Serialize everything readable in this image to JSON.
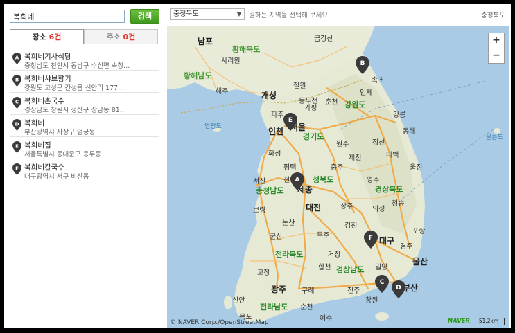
{
  "search": {
    "value": "복희네",
    "button": "검색"
  },
  "tabs": [
    {
      "label": "장소",
      "count": "6건"
    },
    {
      "label": "주소",
      "count": "0건"
    }
  ],
  "results": [
    {
      "marker": "A",
      "title": "복희네기사식당",
      "address": "충청남도 천안시 동남구 수신면 속창..."
    },
    {
      "marker": "B",
      "title": "복희네샤브향기",
      "address": "강원도 고성군 간성읍 신안리 177..."
    },
    {
      "marker": "C",
      "title": "복희네촌국수",
      "address": "경상남도 창원시 성산구 상남동 81..."
    },
    {
      "marker": "D",
      "title": "복희네",
      "address": "부산광역시 사상구 엄궁동"
    },
    {
      "marker": "E",
      "title": "복희네집",
      "address": "서울특별시 동대문구 용두동"
    },
    {
      "marker": "F",
      "title": "복희네칼국수",
      "address": "대구광역시 서구 비산동"
    }
  ],
  "mapbar": {
    "region": "충청북도",
    "hint": "원하는 지역을 선택해 보세요",
    "current": "충청북도"
  },
  "map": {
    "zoom_in": "+",
    "zoom_out": "−",
    "copyright": "© NAVER Corp./OpenStreetMap",
    "logo": "NAVER",
    "scale": "51.2km",
    "labels": {
      "nampo": "남포",
      "hwanghae_n": "황해북도",
      "sariwon": "사리원",
      "geumgang": "금강산",
      "hwanghae_s": "황해남도",
      "haeju": "해주",
      "gaeseong": "개성",
      "cheorwon": "철원",
      "inje": "인제",
      "sokcho": "속초",
      "chuncheon": "춘천",
      "gapyeong": "가평",
      "gangwon": "강원도",
      "paju": "파주",
      "dongducheon": "동두천",
      "yeonpyeong": "연평도",
      "incheon": "인천",
      "seoul": "서울",
      "gangneung": "강릉",
      "donghae": "동해",
      "gyeonggi": "경기도",
      "wonju": "원주",
      "ulleung": "울릉도",
      "jeongseon": "정선",
      "hwaseong": "화성",
      "jecheon": "제천",
      "taebaek": "태백",
      "pyeongtaek": "평택",
      "chungju": "충주",
      "uljin": "울진",
      "seosan": "서산",
      "cheonan": "천안",
      "chungbuk": "청북도",
      "sejong": "세종",
      "chungnam": "충청남도",
      "yeongju": "영주",
      "gyeongbuk": "경상북도",
      "boryeong": "보령",
      "daejeon": "대전",
      "sangju": "상주",
      "uiseong": "의성",
      "cheongsong": "청송",
      "nonsan": "논산",
      "gimcheon": "김천",
      "pohang": "포항",
      "gunsan": "군산",
      "muju": "무주",
      "daegu": "대구",
      "gyeongju": "경주",
      "jeonbuk": "전라북도",
      "geochang": "거창",
      "ulsan": "울산",
      "gochang": "고창",
      "hapcheon": "합천",
      "gyeongnam": "경상남도",
      "miryang": "밀양",
      "gwangju": "광주",
      "gurye": "구례",
      "jinju": "진주",
      "busan": "부산",
      "changwon": "창원",
      "sinan": "신안",
      "jeonnam": "전라남도",
      "suncheon": "순천",
      "mokpo": "목포",
      "yeosu": "여수"
    },
    "pins": [
      "A",
      "B",
      "C",
      "D",
      "E",
      "F"
    ]
  },
  "colors": {
    "accent_green": "#4aa52a",
    "count_red": "#e03a2f",
    "pin": "#3a3a3a",
    "road": "#f2b35a",
    "sea": "#a9cbe6",
    "land": "#e8ead6"
  }
}
